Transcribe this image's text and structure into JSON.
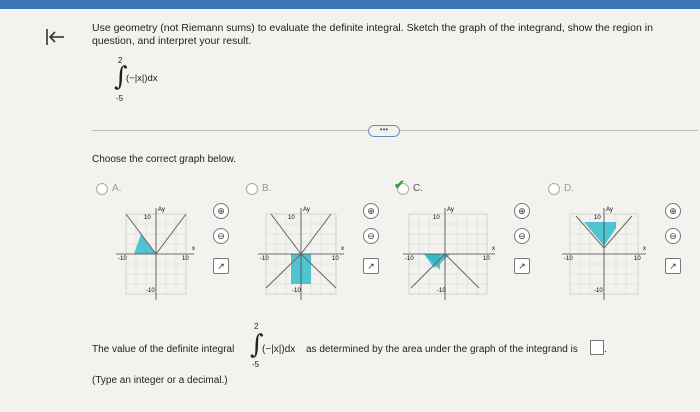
{
  "question": {
    "text": "Use geometry (not Riemann sums) to evaluate the definite integral. Sketch the graph of the integrand, show the region in question, and interpret your result.",
    "upper": "2",
    "lower": "-5",
    "integrand": "(−|x|)dx"
  },
  "more_button": "•••",
  "choose_text": "Choose the correct graph below.",
  "options": [
    {
      "label": "A.",
      "selected": false
    },
    {
      "label": "B.",
      "selected": false
    },
    {
      "label": "C.",
      "selected": true
    },
    {
      "label": "D.",
      "selected": false
    }
  ],
  "graph_labels": {
    "y": "Ay",
    "x": "x",
    "top": "10",
    "left": "-10",
    "right": "10",
    "bottom": "-10"
  },
  "tools": {
    "zoom_in": "⊕",
    "zoom_out": "⊖",
    "popout": "↗"
  },
  "answer": {
    "prefix": "The value of the definite integral",
    "upper": "2",
    "lower": "-5",
    "integrand": "(−|x|)dx",
    "suffix": "as determined by the area under the graph of the integrand is",
    "end": ".",
    "note": "(Type an integer or a decimal.)"
  },
  "colors": {
    "shade": "#28b8c9",
    "accent": "#3a76b5",
    "check": "#3f9b3b"
  },
  "icons": [
    "back-arrow-icon",
    "zoom-in-icon",
    "zoom-out-icon",
    "popout-icon",
    "check-icon"
  ]
}
